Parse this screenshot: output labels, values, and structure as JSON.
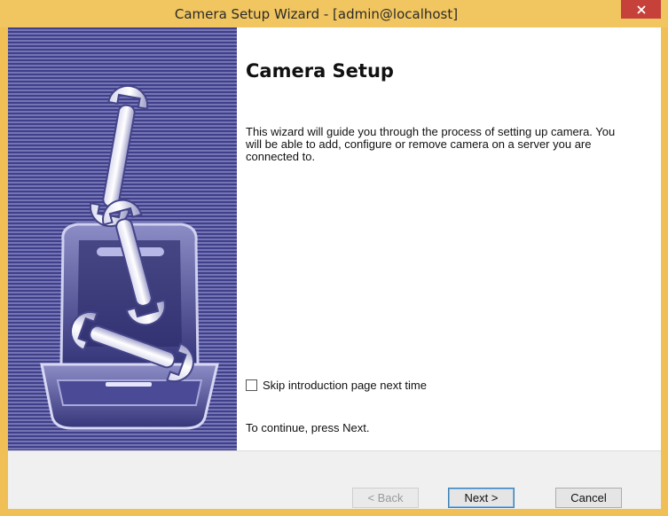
{
  "window": {
    "title": "Camera Setup Wizard - [admin@localhost]",
    "close_symbol": "×"
  },
  "side_panel": {
    "illustration": "toolbox-with-wrenches"
  },
  "content": {
    "heading": "Camera Setup",
    "intro_text": "This wizard will guide you through the process of setting up camera. You will be able to add, configure or remove camera on a server you are connected to.",
    "skip_checkbox_label": "Skip introduction page next time",
    "skip_checked": false,
    "continue_text": "To continue, press Next."
  },
  "buttons": {
    "back_label": "< Back",
    "next_label": "Next >",
    "cancel_label": "Cancel"
  },
  "colors": {
    "title_bar": "#f1c55f",
    "close_button": "#c7413b",
    "side_panel_dark": "#3f3f8a",
    "side_panel_light": "#7575b5"
  }
}
